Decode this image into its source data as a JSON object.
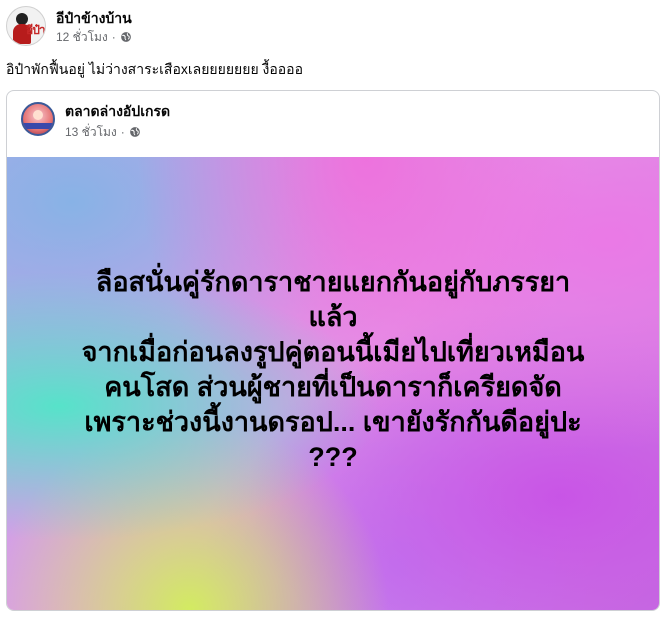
{
  "post": {
    "author": "อีป๋าข้างบ้าน",
    "time": "12 ชั่วโมง",
    "dot": "·",
    "caption": "อิป๋าพักฟื้นอยู่ ไม่ว่างสาระเสือxเลยยยยยยย งื้ออออ",
    "avatar_icon": "page-logo-icon",
    "audience_icon": "globe-icon"
  },
  "shared_post": {
    "author": "ตลาดล่างอัปเกรด",
    "time": "13 ชั่วโมง",
    "dot": "·",
    "avatar_icon": "page-avatar-icon",
    "audience_icon": "globe-icon",
    "image_text_lines": [
      "ลือสนั่นคู่รักดาราชายแยกกันอยู่กับภรรยา",
      "แล้ว",
      "จากเมื่อก่อนลงรูปคู่ตอนนี้เมียไปเที่ยวเหมือน",
      "คนโสด ส่วนผู้ชายที่เป็นดาราก็เครียดจัด",
      "เพราะช่วงนี้งานดรอป... เขายังรักกันดีอยู่ปะ",
      "???"
    ]
  },
  "colors": {
    "text_primary": "#050505",
    "text_secondary": "#65676b",
    "border": "#ced0d4"
  }
}
